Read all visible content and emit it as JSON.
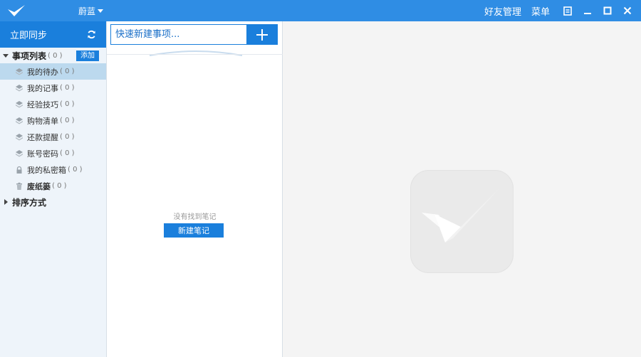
{
  "titlebar": {
    "skin_label": "蔚蓝",
    "friends_label": "好友管理",
    "menu_label": "菜单"
  },
  "sidebar": {
    "sync_label": "立即同步",
    "list_title": "事项列表",
    "list_count": "( 0 )",
    "add_label": "添加",
    "items": [
      {
        "label": "我的待办",
        "count": "( 0 )",
        "icon": "layers-icon"
      },
      {
        "label": "我的记事",
        "count": "( 0 )",
        "icon": "layers-icon"
      },
      {
        "label": "经验技巧",
        "count": "( 0 )",
        "icon": "layers-icon"
      },
      {
        "label": "购物清单",
        "count": "( 0 )",
        "icon": "layers-icon"
      },
      {
        "label": "还款提醒",
        "count": "( 0 )",
        "icon": "layers-icon"
      },
      {
        "label": "账号密码",
        "count": "( 0 )",
        "icon": "layers-icon"
      },
      {
        "label": "我的私密箱",
        "count": "( 0 )",
        "icon": "lock-icon"
      },
      {
        "label": "废纸篓",
        "count": "( 0 )",
        "icon": "trash-icon"
      }
    ],
    "sort_label": "排序方式"
  },
  "middle": {
    "quick_placeholder": "快速新建事项...",
    "empty_text": "没有找到笔记",
    "new_note_label": "新建笔记"
  },
  "colors": {
    "titlebar": "#2f8de4",
    "accent": "#1a7fdc",
    "active_item": "#bcd9ee"
  }
}
